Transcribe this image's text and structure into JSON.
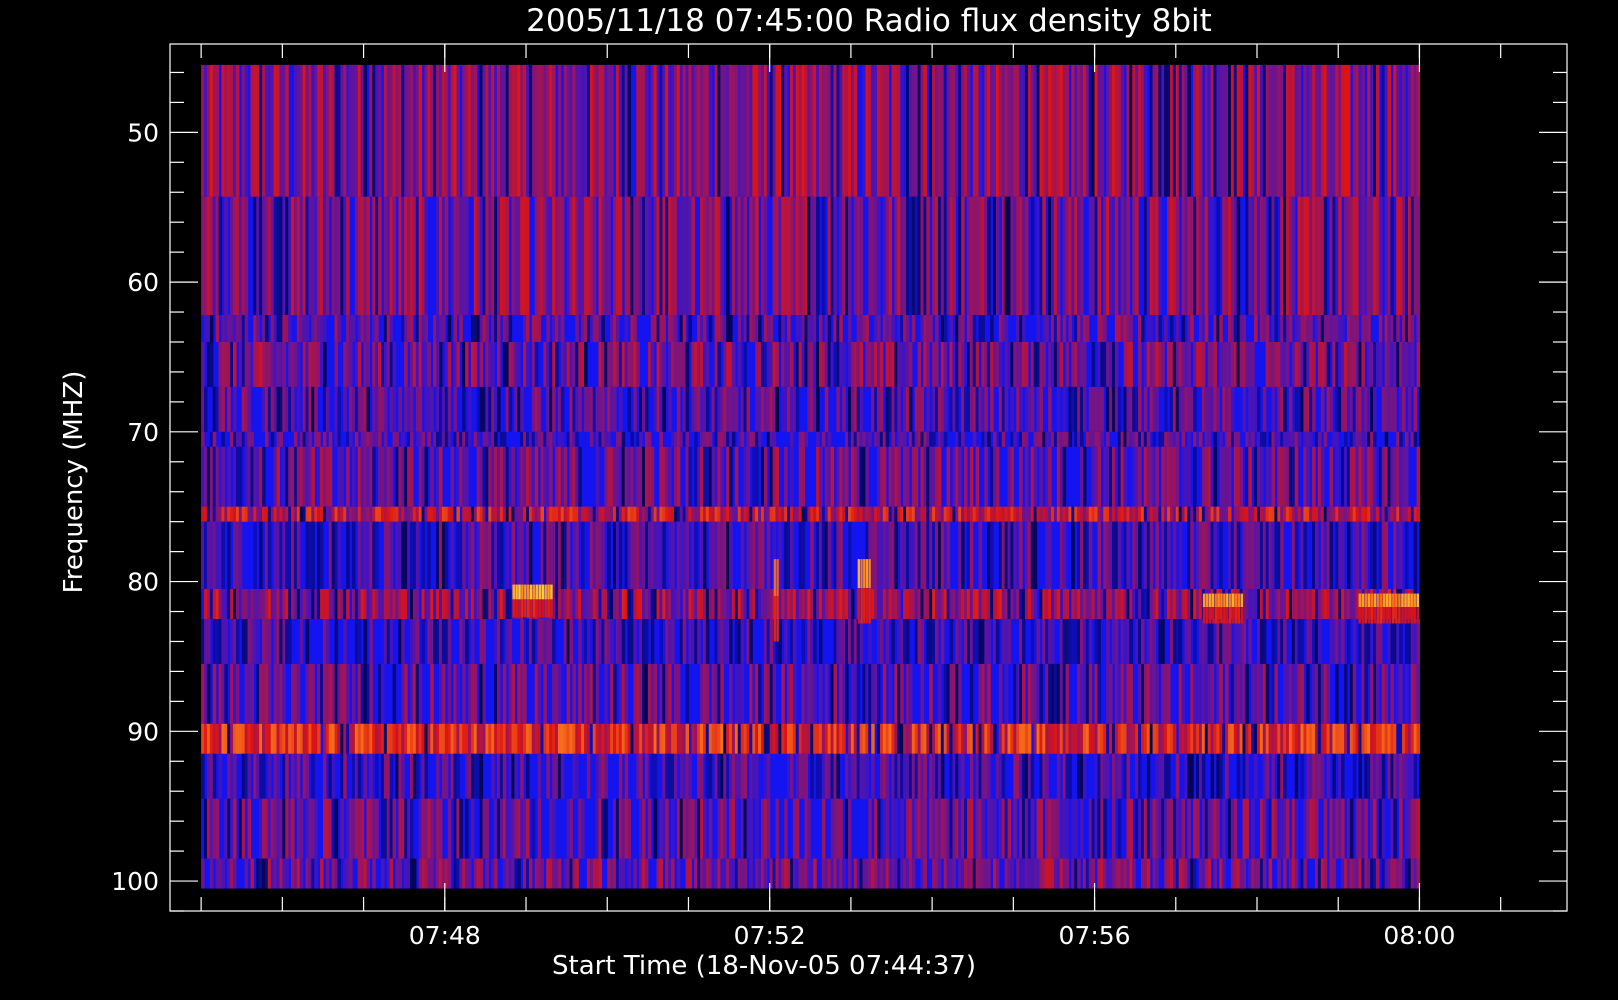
{
  "chart_data": {
    "type": "heatmap",
    "title": "2005/11/18 07:45:00 Radio flux density 8bit",
    "xlabel": "Start Time (18-Nov-05 07:44:37)",
    "ylabel": "Frequency (MHZ)",
    "x_range": [
      "07:44:37",
      "08:01:49"
    ],
    "data_time_range": [
      "07:45:00",
      "08:00:00"
    ],
    "y_range": [
      44.1,
      102.0
    ],
    "data_freq_range": [
      45.5,
      100.5
    ],
    "y_inverted": true,
    "x_tick_labels": [
      {
        "time": "07:48",
        "label": "07:48"
      },
      {
        "time": "07:52",
        "label": "07:52"
      },
      {
        "time": "07:56",
        "label": "07:56"
      },
      {
        "time": "08:00",
        "label": "08:00"
      }
    ],
    "x_minor_times": [
      "07:45",
      "07:46",
      "07:47",
      "07:48",
      "07:49",
      "07:50",
      "07:51",
      "07:52",
      "07:53",
      "07:54",
      "07:55",
      "07:56",
      "07:57",
      "07:58",
      "07:59",
      "08:00",
      "08:01"
    ],
    "y_tick_labels": [
      {
        "value": 50,
        "label": "50"
      },
      {
        "value": 60,
        "label": "60"
      },
      {
        "value": 70,
        "label": "70"
      },
      {
        "value": 80,
        "label": "80"
      },
      {
        "value": 90,
        "label": "90"
      },
      {
        "value": 100,
        "label": "100"
      }
    ],
    "y_minor_step": 2,
    "grid": false,
    "colormap": "black-blue-red-orange-yellow",
    "colors": {
      "background": "#000000",
      "axes": "#ffffff",
      "base": "#1414f0",
      "dark": "#0a0a3c",
      "purple": "#5a1a9a",
      "red": "#dc1414",
      "orange": "#ff8c1e",
      "yellow": "#ffff3c"
    },
    "frequency_bands": [
      {
        "f0": 45.5,
        "f1": 54.3,
        "level": 0.38
      },
      {
        "f0": 54.3,
        "f1": 62.2,
        "level": 0.36
      },
      {
        "f0": 62.2,
        "f1": 64.0,
        "level": 0.3
      },
      {
        "f0": 64.0,
        "f1": 67.0,
        "level": 0.34
      },
      {
        "f0": 67.0,
        "f1": 70.0,
        "level": 0.28
      },
      {
        "f0": 70.0,
        "f1": 71.0,
        "level": 0.26
      },
      {
        "f0": 71.0,
        "f1": 75.0,
        "level": 0.32
      },
      {
        "f0": 75.0,
        "f1": 76.0,
        "level": 0.48
      },
      {
        "f0": 76.0,
        "f1": 80.5,
        "level": 0.26
      },
      {
        "f0": 80.5,
        "f1": 82.5,
        "level": 0.4
      },
      {
        "f0": 82.5,
        "f1": 85.5,
        "level": 0.24
      },
      {
        "f0": 85.5,
        "f1": 89.5,
        "level": 0.3
      },
      {
        "f0": 89.5,
        "f1": 91.5,
        "level": 0.56
      },
      {
        "f0": 91.5,
        "f1": 94.5,
        "level": 0.26
      },
      {
        "f0": 94.5,
        "f1": 98.5,
        "level": 0.32
      },
      {
        "f0": 98.5,
        "f1": 100.5,
        "level": 0.34
      }
    ],
    "bursts": [
      {
        "t0": "07:48:50",
        "t1": "07:49:20",
        "f0": 80.2,
        "f1": 82.4,
        "level": 0.95
      },
      {
        "t0": "07:52:03",
        "t1": "07:52:07",
        "f0": 78.5,
        "f1": 84.0,
        "level": 0.85
      },
      {
        "t0": "07:53:05",
        "t1": "07:53:15",
        "f0": 78.5,
        "f1": 82.8,
        "level": 0.9
      },
      {
        "t0": "07:57:20",
        "t1": "07:57:50",
        "f0": 80.8,
        "f1": 82.8,
        "level": 0.88
      },
      {
        "t0": "07:59:15",
        "t1": "08:00:00",
        "f0": 80.8,
        "f1": 82.8,
        "level": 0.88
      }
    ]
  }
}
